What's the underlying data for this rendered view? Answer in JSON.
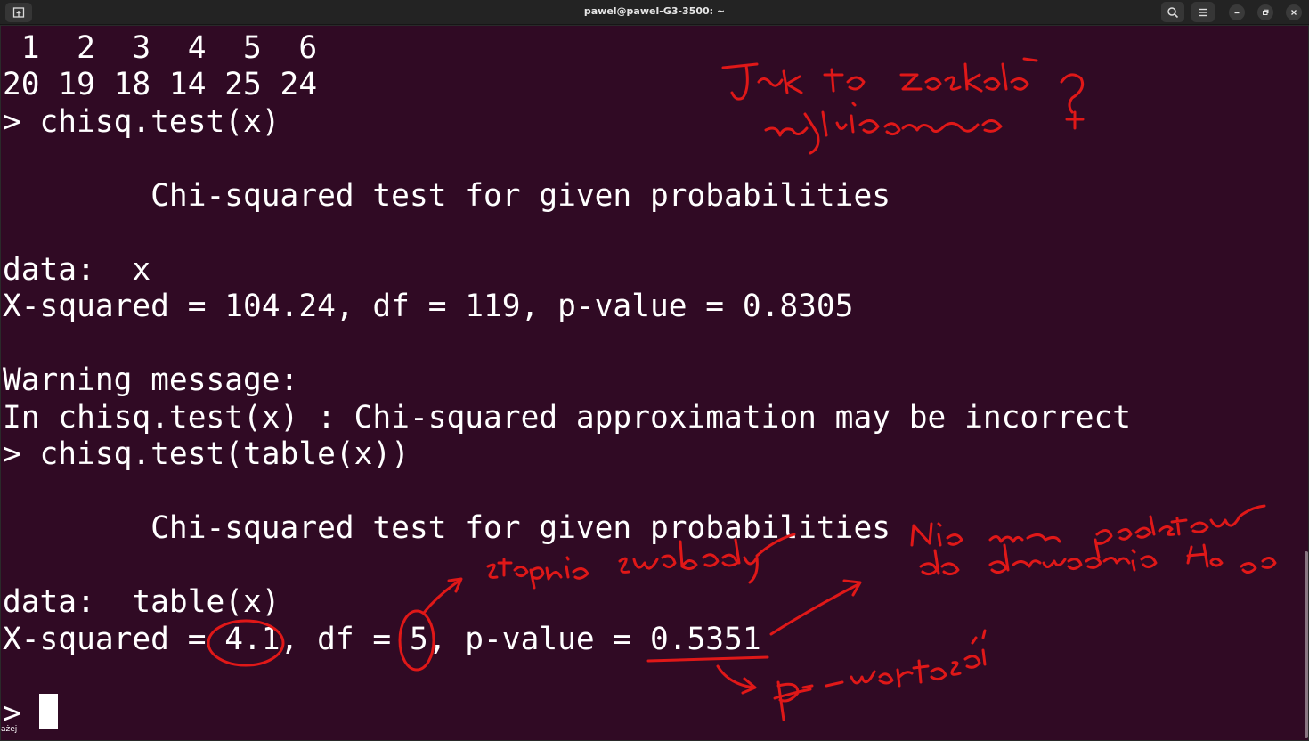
{
  "window": {
    "title": "pawel@pawel-G3-3500: ~",
    "buttons": {
      "new_tab_icon": "new-tab-icon",
      "search_icon": "search-icon",
      "menu_icon": "hamburger-menu-icon",
      "minimize_icon": "minimize-icon",
      "maximize_icon": "restore-icon",
      "close_icon": "close-icon"
    }
  },
  "terminal": {
    "lines": [
      " 1  2  3  4  5  6",
      "20 19 18 14 25 24",
      "> chisq.test(x)",
      "",
      "        Chi-squared test for given probabilities",
      "",
      "data:  x",
      "X-squared = 104.24, df = 119, p-value = 0.8305",
      "",
      "Warning message:",
      "In chisq.test(x) : Chi-squared approximation may be incorrect",
      "> chisq.test(table(x))",
      "",
      "        Chi-squared test for given probabilities",
      "",
      "data:  table(x)",
      "X-squared = 4.1, df = 5, p-value = 0.5351",
      "",
      ">"
    ],
    "bottom_label": "ażej"
  },
  "annotations": {
    "ink_color": "#e01818",
    "notes": [
      "Jak to zostało wyliczone ?",
      "stopnie swobody",
      "Nie ma podstaw do odrzucenia H0",
      "p-wartość"
    ]
  }
}
